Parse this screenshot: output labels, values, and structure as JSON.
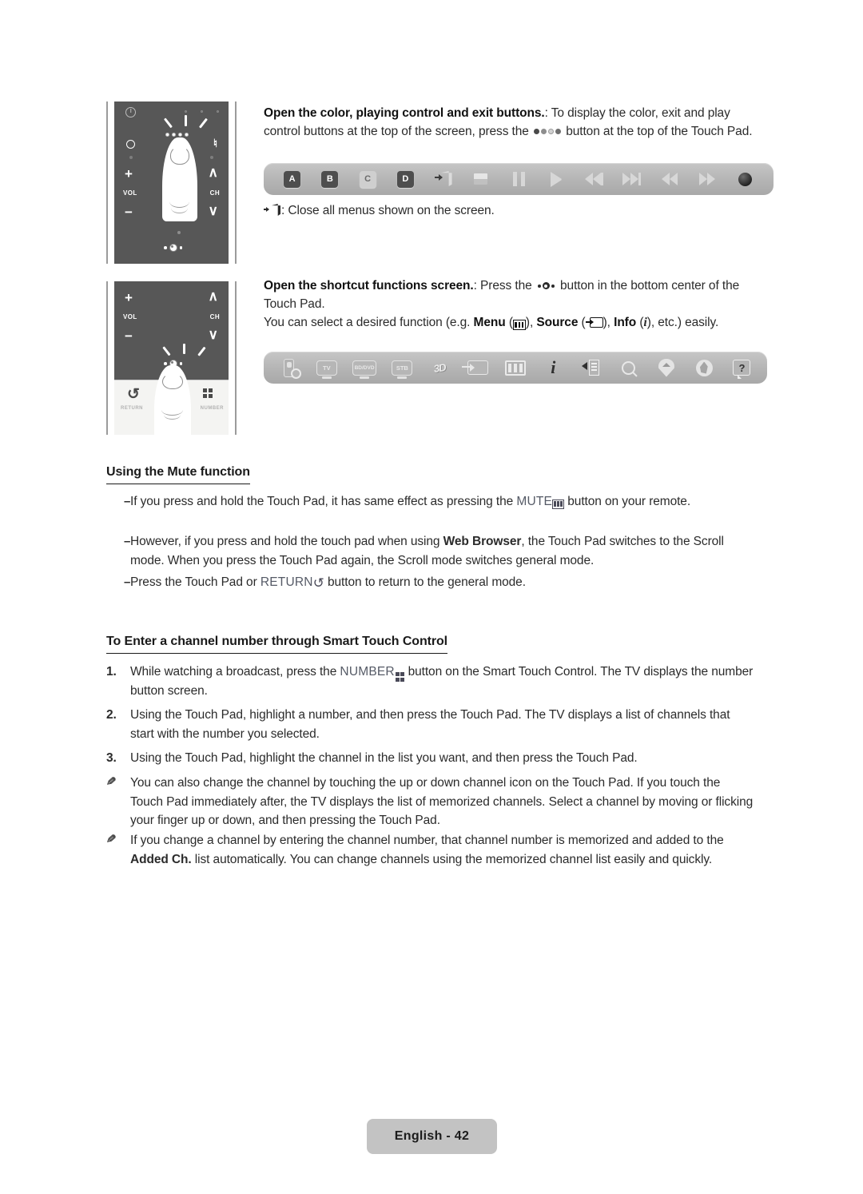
{
  "page": {
    "footer_label": "English - 42"
  },
  "remote_figures": [
    {
      "name": "remote-touchpad-top",
      "labels": {
        "vol": "VOL",
        "ch": "CH",
        "plus": "+",
        "minus": "−",
        "up": "∧",
        "down": "∨"
      }
    },
    {
      "name": "remote-touchpad-bottom",
      "labels": {
        "vol": "VOL",
        "ch": "CH",
        "plus": "+",
        "minus": "−",
        "up": "∧",
        "down": "∨",
        "return": "RETURN",
        "number": "NUMBER"
      }
    }
  ],
  "sections": {
    "color_buttons": {
      "lead_bold": "Open the color, playing control and exit buttons.",
      "text_1": ": To display the color, exit and play control buttons at the top of the screen, press the ",
      "text_2": " button at the top of the Touch Pad.",
      "exit_note_text": ": Close all menus shown on the screen."
    },
    "shortcut": {
      "lead_bold": "Open the shortcut functions screen.",
      "text_1": ": Press the ",
      "text_2": " button in the bottom center of the Touch Pad.",
      "text_3": "You can select a desired function (e.g. ",
      "menu_label": "Menu",
      "menu_open": " (",
      "menu_close": "), ",
      "source_label": "Source",
      "source_open": " (",
      "source_close": "), ",
      "info_label": "Info",
      "info_open": " (",
      "info_glyph": "i",
      "info_close": "), etc.) easily."
    }
  },
  "play_bar": {
    "name": "playing-control-bar",
    "buttons": [
      {
        "name": "color-button-a",
        "label": "A",
        "style": "dark"
      },
      {
        "name": "color-button-b",
        "label": "B",
        "style": "dark"
      },
      {
        "name": "color-button-c",
        "label": "C",
        "style": "light"
      },
      {
        "name": "color-button-d",
        "label": "D",
        "style": "dark"
      },
      {
        "name": "exit-icon",
        "label": ""
      },
      {
        "name": "stop-icon",
        "label": ""
      },
      {
        "name": "pause-icon",
        "label": ""
      },
      {
        "name": "play-icon",
        "label": ""
      },
      {
        "name": "previous-icon",
        "label": ""
      },
      {
        "name": "next-icon",
        "label": ""
      },
      {
        "name": "rewind-icon",
        "label": ""
      },
      {
        "name": "fast-forward-icon",
        "label": ""
      },
      {
        "name": "record-icon",
        "label": ""
      }
    ]
  },
  "shortcut_bar": {
    "name": "shortcut-functions-bar",
    "buttons": [
      {
        "name": "universal-remote-setup-icon",
        "label": ""
      },
      {
        "name": "tv-source-icon",
        "label": "TV"
      },
      {
        "name": "bd-dvd-source-icon",
        "label": "BD/DVD"
      },
      {
        "name": "stb-source-icon",
        "label": "STB"
      },
      {
        "name": "three-d-icon",
        "label": "3D"
      },
      {
        "name": "source-icon",
        "label": ""
      },
      {
        "name": "menu-icon",
        "label": ""
      },
      {
        "name": "info-icon",
        "label": "i"
      },
      {
        "name": "history-back-icon",
        "label": ""
      },
      {
        "name": "search-icon",
        "label": ""
      },
      {
        "name": "smart-hub-home-icon",
        "label": ""
      },
      {
        "name": "apps-icon",
        "label": ""
      },
      {
        "name": "e-manual-help-icon",
        "label": "?"
      }
    ]
  },
  "mute_section": {
    "heading": "Using the Mute function",
    "items": [
      {
        "marker": "–",
        "pre": "If you press and hold the Touch Pad, it has same effect as pressing the ",
        "key": "MUTE",
        "post": " button on your remote."
      },
      {
        "marker": "–",
        "pre": "However, if you press and hold the touch pad when using ",
        "bold": "Web Browser",
        "post": ", the Touch Pad switches to the Scroll mode. When you press the Touch Pad again, the Scroll mode switches general mode."
      },
      {
        "marker": "–",
        "pre": "Press the Touch Pad or ",
        "key": "RETURN",
        "post": " button to return to the general mode."
      }
    ]
  },
  "channel_section": {
    "heading": "To Enter a channel number through Smart Touch Control",
    "items": [
      {
        "marker": "1.",
        "pre": "While watching a broadcast, press the ",
        "key": "NUMBER",
        "post": " button on the Smart Touch Control. The TV displays the number button screen."
      },
      {
        "marker": "2.",
        "pre": "Using the Touch Pad, highlight a number, and then press the Touch Pad. The TV displays a list of channels that start with the number you selected.",
        "key": "",
        "post": ""
      },
      {
        "marker": "3.",
        "pre": "Using the Touch Pad, highlight the channel in the list you want, and then press the Touch Pad.",
        "key": "",
        "post": ""
      }
    ],
    "notes": [
      {
        "pre": "You can also change the channel by touching the up or down channel icon on the Touch Pad. If you touch the Touch Pad immediately after, the TV displays the list of memorized channels. Select a channel by moving or flicking your finger up or down, and then pressing the Touch Pad.",
        "bold": "",
        "post": ""
      },
      {
        "pre": "If you change a channel by entering the channel number, that channel number is memorized and added to the ",
        "bold": "Added Ch.",
        "post": " list automatically. You can change channels using the memorized channel list easily and quickly."
      }
    ]
  },
  "colors": {
    "bar_grey": "#b4b4b4",
    "remote_body": "#575757",
    "text": "#2b2b2b",
    "footer_pill": "#c3c3c3"
  }
}
